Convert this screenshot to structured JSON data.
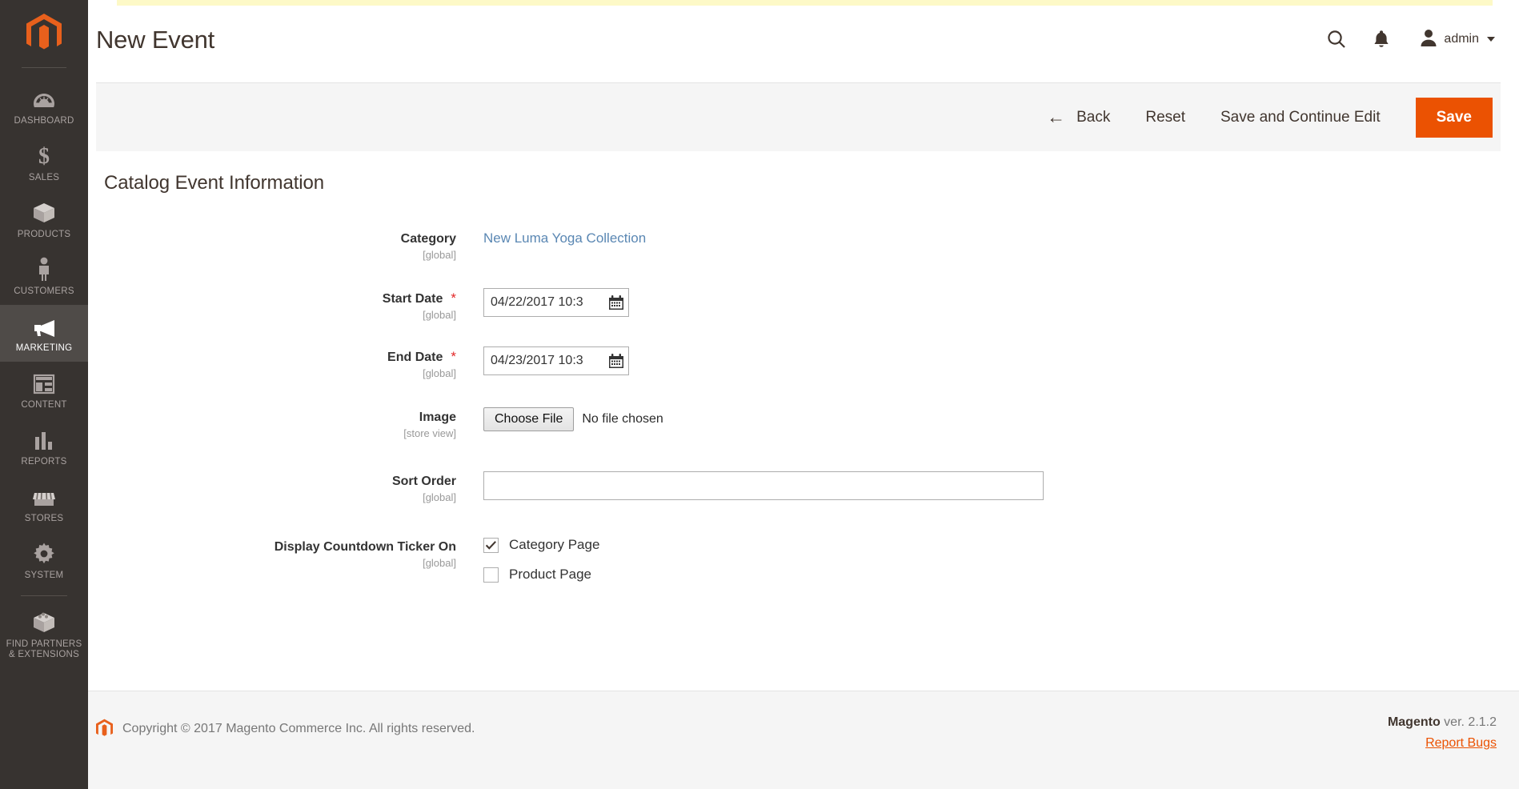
{
  "sidebar": {
    "logo_name": "magento-logo",
    "items": [
      {
        "label": "DASHBOARD",
        "icon": "dashboard-gauge-icon",
        "active": false
      },
      {
        "label": "SALES",
        "icon": "dollar-sign-icon",
        "active": false
      },
      {
        "label": "PRODUCTS",
        "icon": "box-icon",
        "active": false
      },
      {
        "label": "CUSTOMERS",
        "icon": "person-icon",
        "active": false
      },
      {
        "label": "MARKETING",
        "icon": "megaphone-icon",
        "active": true
      },
      {
        "label": "CONTENT",
        "icon": "layout-window-icon",
        "active": false
      },
      {
        "label": "REPORTS",
        "icon": "bar-chart-icon",
        "active": false
      },
      {
        "label": "STORES",
        "icon": "storefront-icon",
        "active": false
      },
      {
        "label": "SYSTEM",
        "icon": "gear-icon",
        "active": false
      },
      {
        "label": "FIND PARTNERS\n& EXTENSIONS",
        "icon": "puzzle-box-icon",
        "active": false
      }
    ]
  },
  "header": {
    "title": "New Event",
    "search_icon": "search-icon",
    "notifications_icon": "bell-icon",
    "account_icon": "user-avatar-icon",
    "account_name": "admin"
  },
  "page_actions": {
    "back_label": "Back",
    "back_icon": "arrow-left-icon",
    "reset_label": "Reset",
    "save_continue_label": "Save and Continue Edit",
    "save_label": "Save",
    "save_color": "#eb5202"
  },
  "form": {
    "section_title": "Catalog Event Information",
    "fields": {
      "category": {
        "label": "Category",
        "scope": "[global]",
        "value": "New Luma Yoga Collection"
      },
      "start_date": {
        "label": "Start Date",
        "scope": "[global]",
        "required_marker": "*",
        "value": "04/22/2017 10:3",
        "calendar_icon": "calendar-icon"
      },
      "end_date": {
        "label": "End Date",
        "scope": "[global]",
        "required_marker": "*",
        "value": "04/23/2017 10:3",
        "calendar_icon": "calendar-icon"
      },
      "image": {
        "label": "Image",
        "scope": "[store view]",
        "choose_file_label": "Choose File",
        "file_status": "No file chosen"
      },
      "sort_order": {
        "label": "Sort Order",
        "scope": "[global]",
        "value": "",
        "placeholder": ""
      },
      "ticker": {
        "label": "Display Countdown Ticker On",
        "scope": "[global]",
        "options": [
          {
            "label": "Category Page",
            "checked": true
          },
          {
            "label": "Product Page",
            "checked": false
          }
        ]
      }
    }
  },
  "footer": {
    "logo_name": "magento-footer-logo",
    "copyright": "Copyright © 2017 Magento Commerce Inc. All rights reserved.",
    "brand": "Magento",
    "version": " ver. 2.1.2",
    "report_bugs": "Report Bugs"
  }
}
